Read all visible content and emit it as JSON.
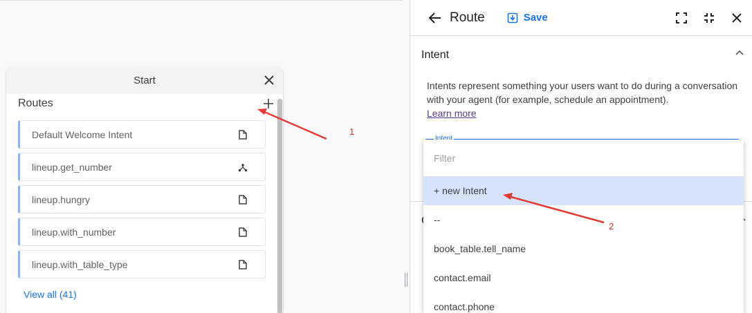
{
  "start_card": {
    "title": "Start",
    "routes_title": "Routes",
    "routes": [
      {
        "label": "Default Welcome Intent",
        "icon": "document-icon"
      },
      {
        "label": "lineup.get_number",
        "icon": "branch-icon"
      },
      {
        "label": "lineup.hungry",
        "icon": "document-icon"
      },
      {
        "label": "lineup.with_number",
        "icon": "document-icon"
      },
      {
        "label": "lineup.with_table_type",
        "icon": "document-icon"
      }
    ],
    "view_all": "View all (41)"
  },
  "panel": {
    "title": "Route",
    "save_label": "Save",
    "section_title": "Intent",
    "description": "Intents represent something your users want to do during a conversation with your agent (for example, schedule an appointment).",
    "learn_more": "Learn more",
    "intent_field_label": "Intent",
    "next_section_letter": "C"
  },
  "dropdown": {
    "filter_placeholder": "Filter",
    "items": [
      "+ new Intent",
      "--",
      "book_table.tell_name",
      "contact.email",
      "contact.phone"
    ]
  },
  "annotations": {
    "marker_1": "1",
    "marker_2": "2",
    "color": "#d32f2f"
  },
  "colors": {
    "accent": "#1a73e8",
    "route_border": "#8ab4f8",
    "highlight": "#d6e4fb"
  }
}
